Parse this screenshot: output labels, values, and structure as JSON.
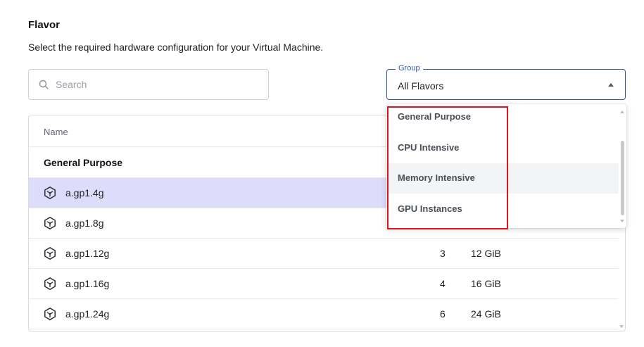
{
  "section": {
    "title": "Flavor",
    "subtitle": "Select the required hardware configuration for your Virtual Machine."
  },
  "search": {
    "placeholder": "Search",
    "icon": "search-icon"
  },
  "group_select": {
    "label": "Group",
    "value": "All Flavors",
    "icon": "caret-up-icon"
  },
  "table": {
    "columns": [
      "Name"
    ],
    "group_header": "General Purpose",
    "rows": [
      {
        "name": "a.gp1.4g",
        "cpu": "",
        "ram": "",
        "selected": true
      },
      {
        "name": "a.gp1.8g",
        "cpu": "",
        "ram": ""
      },
      {
        "name": "a.gp1.12g",
        "cpu": "3",
        "ram": "12 GiB"
      },
      {
        "name": "a.gp1.16g",
        "cpu": "4",
        "ram": "16 GiB"
      },
      {
        "name": "a.gp1.24g",
        "cpu": "6",
        "ram": "24 GiB"
      }
    ]
  },
  "dropdown": {
    "options": [
      "General Purpose",
      "CPU Intensive",
      "Memory Intensive",
      "GPU Instances"
    ],
    "hovered": "Memory Intensive"
  },
  "colors": {
    "accent": "#2b57a6",
    "selected_row": "#dddcfb",
    "highlight_box": "#e0141f"
  }
}
